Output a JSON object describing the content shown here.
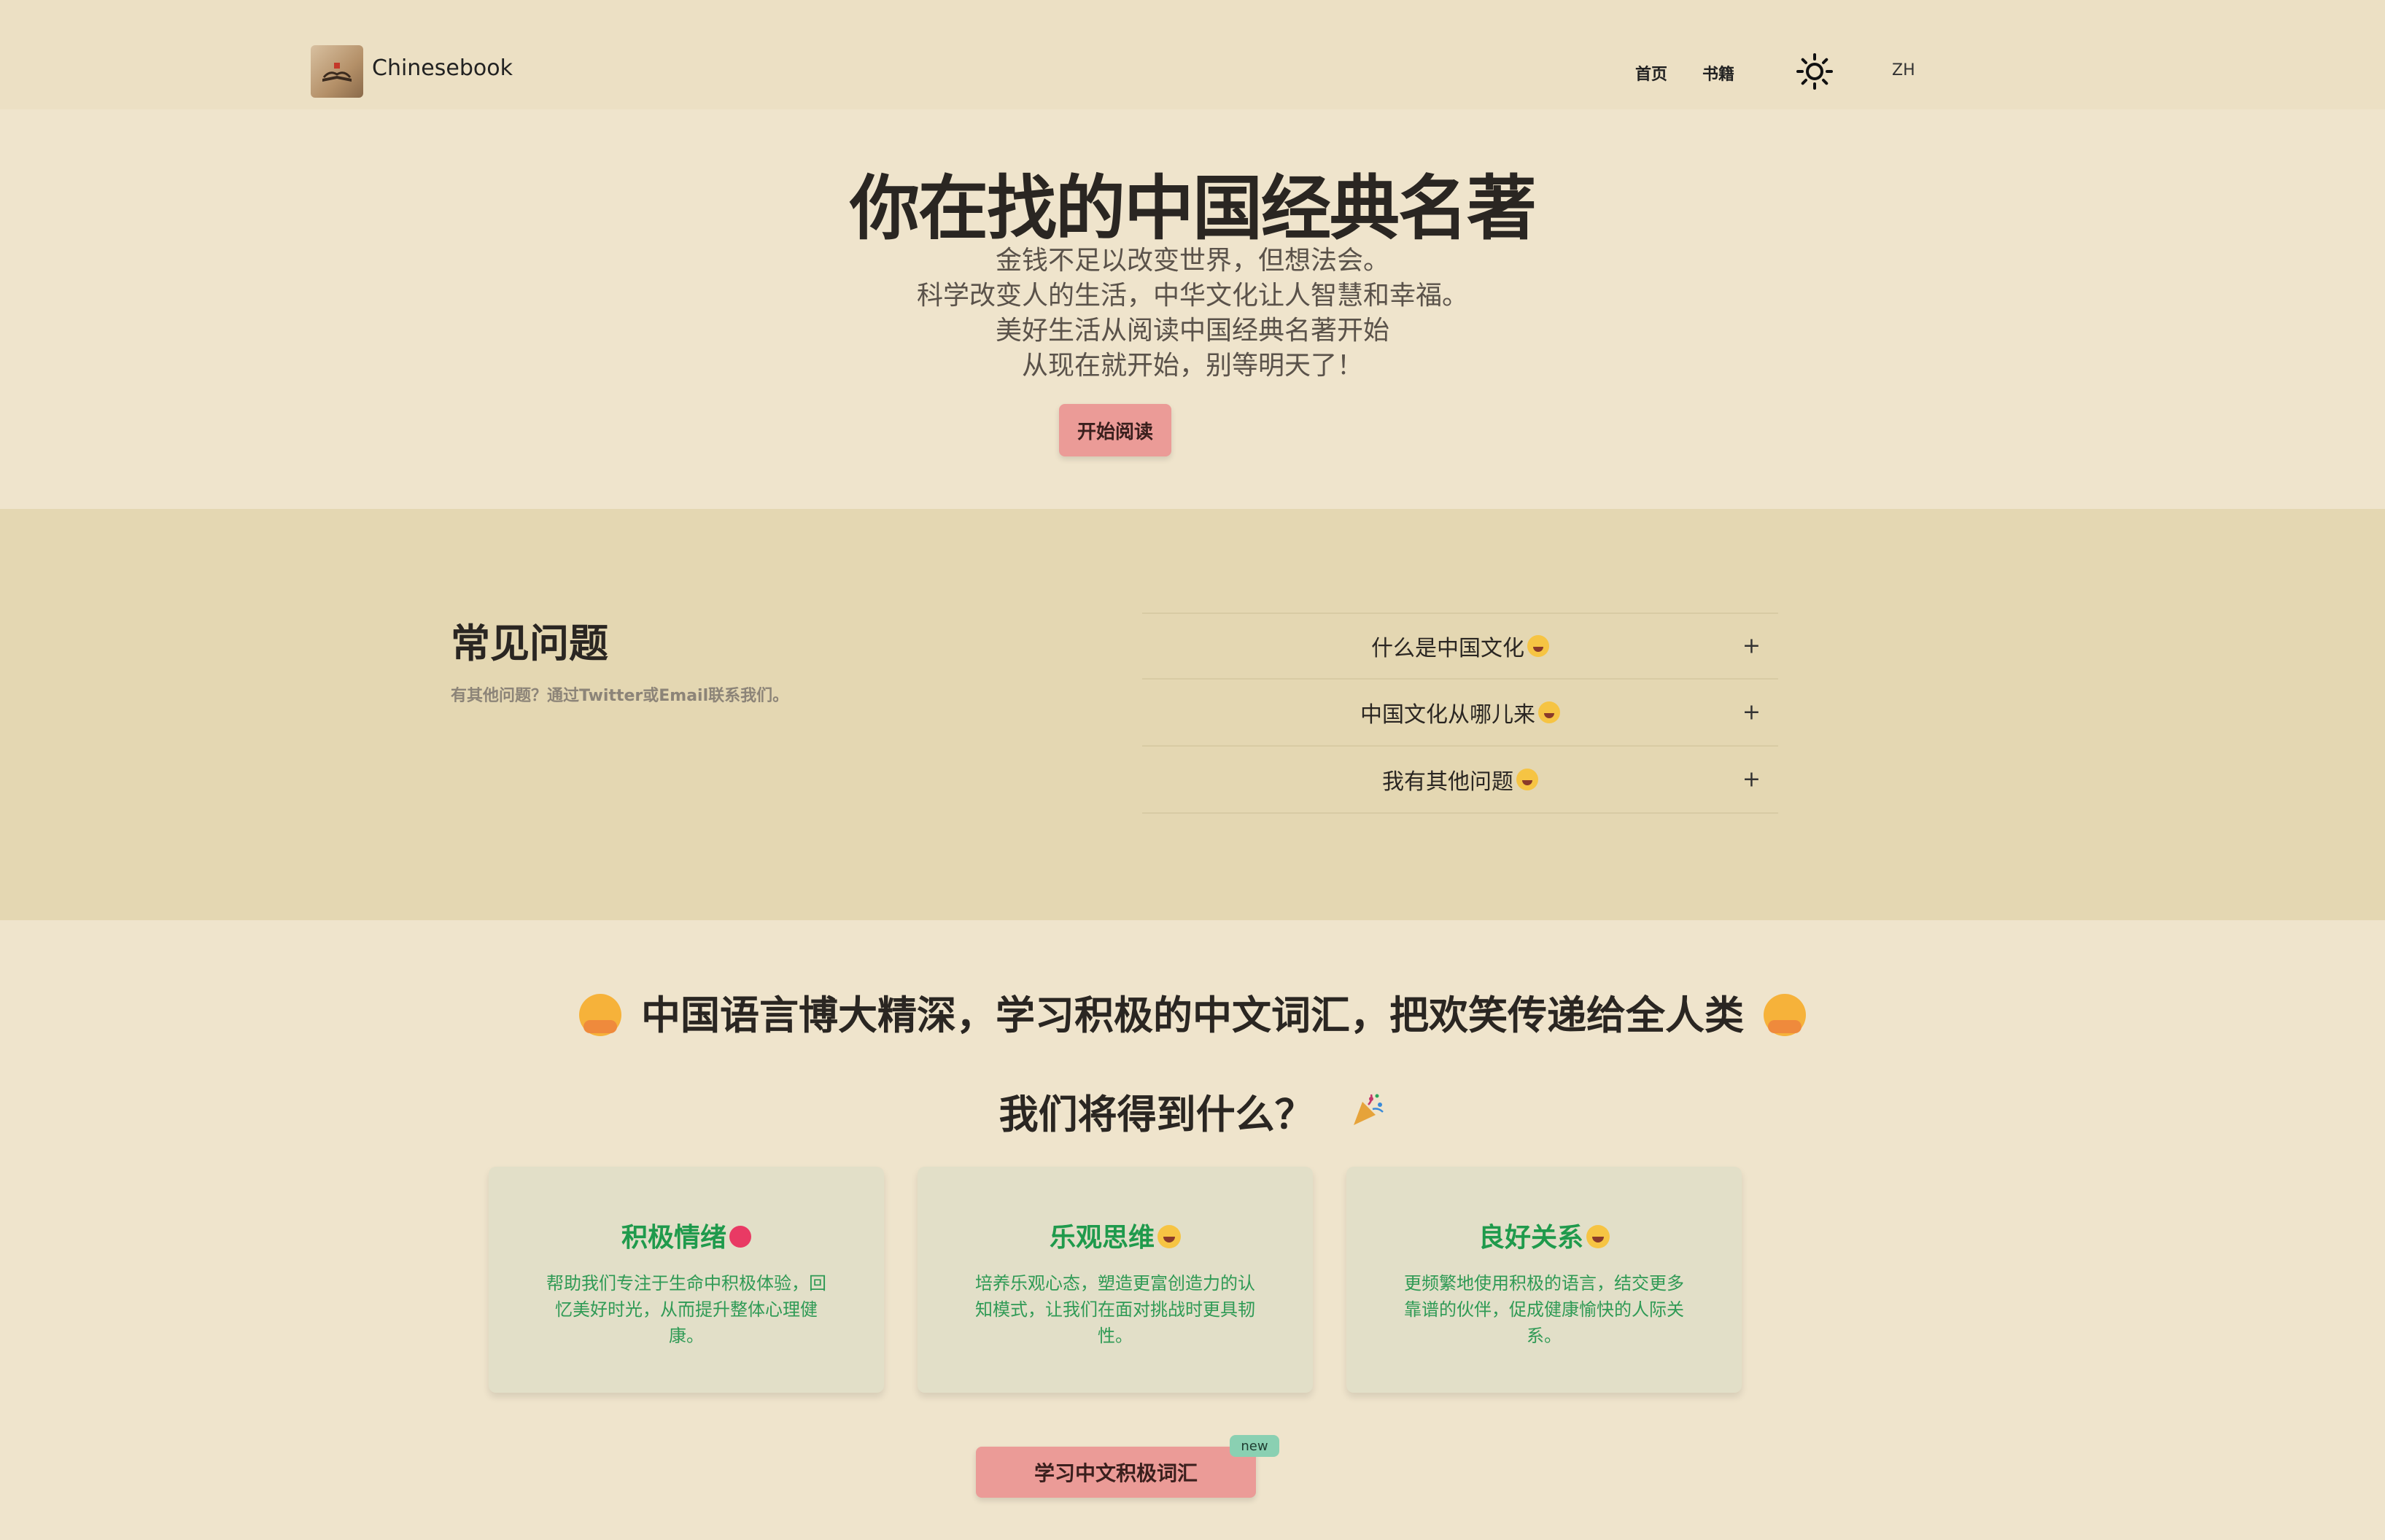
{
  "header": {
    "logo_text": "Chinesebook",
    "nav": [
      "首页",
      "书籍"
    ],
    "theme_icon": "sun-icon",
    "lang": "ZH"
  },
  "hero": {
    "title": "你在找的中国经典名著",
    "lines": [
      "金钱不足以改变世界，但想法会。",
      "科学改变人的生活，中华文化让人智慧和幸福。",
      "美好生活从阅读中国经典名著开始",
      "从现在就开始，别等明天了！"
    ],
    "cta": "开始阅读"
  },
  "faq": {
    "title": "常见问题",
    "subtitle": "有其他问题？通过Twitter或Email联系我们。",
    "items": [
      {
        "q": "什么是中国文化",
        "icon": "tongue-face-emoji"
      },
      {
        "q": "中国文化从哪儿来",
        "icon": "winking-face-emoji"
      },
      {
        "q": "我有其他问题",
        "icon": "grinning-face-emoji"
      }
    ],
    "toggle": "+"
  },
  "vocab": {
    "heading": "中国语言博大精深，学习积极的中文词汇，把欢笑传递给全人类",
    "icon": "hugging-face-emoji"
  },
  "gain": {
    "heading": "我们将得到什么？",
    "icon": "party-popper-emoji",
    "cards": [
      {
        "title": "积极情绪",
        "icon": "heart-emoji",
        "desc": "帮助我们专注于生命中积极体验，回忆美好时光，从而提升整体心理健康。"
      },
      {
        "title": "乐观思维",
        "icon": "grinning-face-emoji",
        "desc": "培养乐观心态，塑造更富创造力的认知模式，让我们在面对挑战时更具韧性。"
      },
      {
        "title": "良好关系",
        "icon": "smiling-face-emoji",
        "desc": "更频繁地使用积极的语言，结交更多靠谱的伙伴，促成健康愉快的人际关系。"
      }
    ],
    "cta": "学习中文积极词汇",
    "badge": "new"
  },
  "colors": {
    "background": "#efe4cc",
    "faq_band": "#e4d7b2",
    "button": "#eb9b97",
    "card_title": "#1f9a4c",
    "card_bg": "#e2dfc8",
    "badge": "#8ad0b2"
  }
}
